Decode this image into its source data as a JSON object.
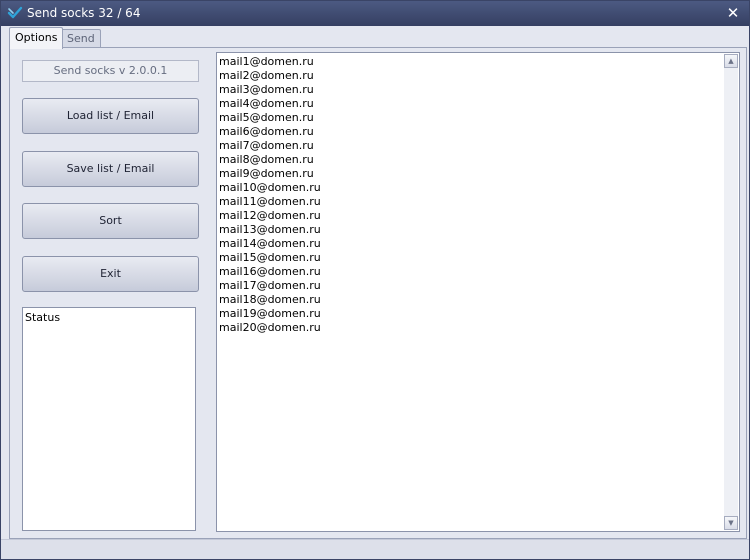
{
  "window": {
    "title": "Send socks 32 / 64",
    "close_glyph": "✕"
  },
  "tabs": [
    {
      "label": "Options",
      "active": true
    },
    {
      "label": "Send",
      "active": false
    }
  ],
  "options": {
    "version": "Send socks v 2.0.0.1",
    "buttons": {
      "load": "Load list / Email",
      "save": "Save list / Email",
      "sort": "Sort",
      "exit": "Exit"
    },
    "status_text": "Status"
  },
  "email_list": [
    "mail1@domen.ru",
    "mail2@domen.ru",
    "mail3@domen.ru",
    "mail4@domen.ru",
    "mail5@domen.ru",
    "mail6@domen.ru",
    "mail7@domen.ru",
    "mail8@domen.ru",
    "mail9@domen.ru",
    "mail10@domen.ru",
    "mail11@domen.ru",
    "mail12@domen.ru",
    "mail13@domen.ru",
    "mail14@domen.ru",
    "mail15@domen.ru",
    "mail16@domen.ru",
    "mail17@domen.ru",
    "mail18@domen.ru",
    "mail19@domen.ru",
    "mail20@domen.ru"
  ],
  "scrollbar": {
    "up_glyph": "▲",
    "down_glyph": "▼"
  },
  "colors": {
    "titlebar": "#3f4a70",
    "accent": "#2fa3d8"
  },
  "icons": {
    "app": "checkmark-logo-icon",
    "close": "close-icon"
  }
}
